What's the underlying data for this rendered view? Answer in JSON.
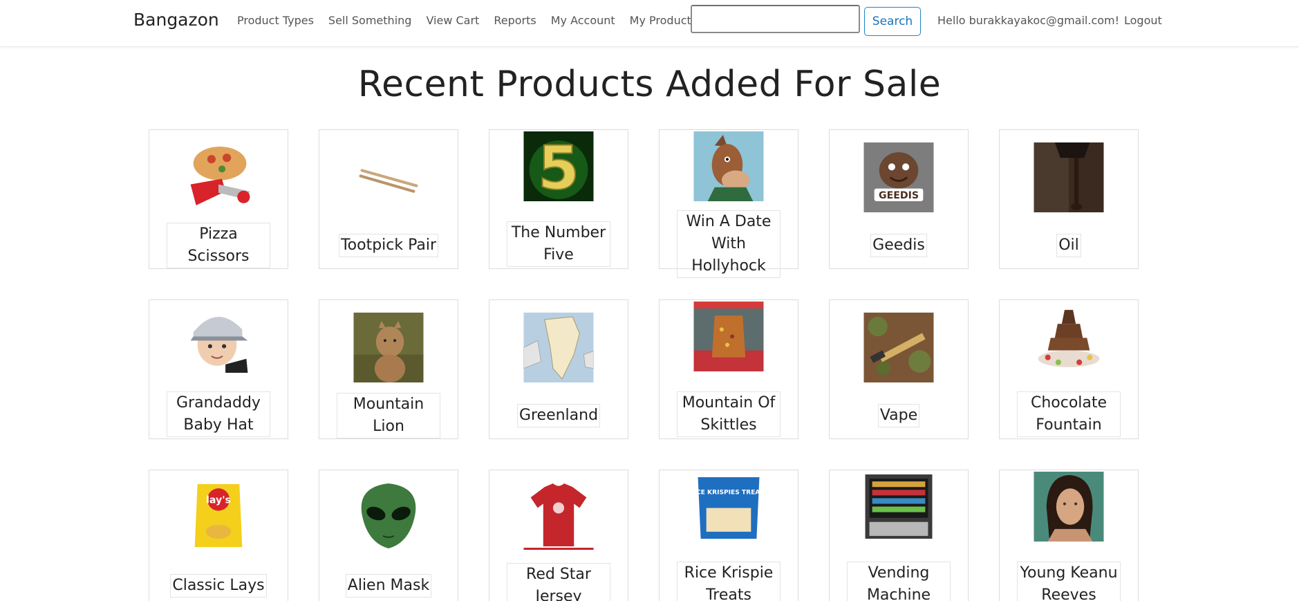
{
  "nav": {
    "brand": "Bangazon",
    "links": [
      "Product Types",
      "Sell Something",
      "View Cart",
      "Reports",
      "My Account",
      "My Products"
    ],
    "search_value": "",
    "search_button": "Search",
    "greeting": "Hello burakkayakoc@gmail.com!",
    "logout": "Logout"
  },
  "page": {
    "title": "Recent Products Added For Sale"
  },
  "products": [
    {
      "name": "Pizza Scissors",
      "icon": "pizza-scissors-image"
    },
    {
      "name": "Tootpick Pair",
      "icon": "toothpicks-image"
    },
    {
      "name": "The Number Five",
      "icon": "number-five-image"
    },
    {
      "name": "Win A Date With Hollyhock",
      "icon": "horse-cartoon-image"
    },
    {
      "name": "Geedis",
      "icon": "geedis-image"
    },
    {
      "name": "Oil",
      "icon": "oil-pour-image"
    },
    {
      "name": "Grandaddy Baby Hat",
      "icon": "baby-hat-image"
    },
    {
      "name": "Mountain Lion",
      "icon": "mountain-lion-image"
    },
    {
      "name": "Greenland",
      "icon": "greenland-map-image"
    },
    {
      "name": "Mountain Of Skittles",
      "icon": "skittles-image"
    },
    {
      "name": "Vape",
      "icon": "vape-image"
    },
    {
      "name": "Chocolate Fountain",
      "icon": "chocolate-fountain-image"
    },
    {
      "name": "Classic Lays",
      "icon": "lays-chips-image"
    },
    {
      "name": "Alien Mask",
      "icon": "alien-mask-image"
    },
    {
      "name": "Red Star Jersey",
      "icon": "red-jersey-image"
    },
    {
      "name": "Rice Krispie Treats",
      "icon": "rice-krispie-box-image"
    },
    {
      "name": "Vending Machine",
      "icon": "vending-machine-image"
    },
    {
      "name": "Young Keanu Reeves",
      "icon": "portrait-image"
    }
  ],
  "image_text": {
    "geedis_label": "GEEDIS",
    "lays_label": "lay's",
    "krispie_label": "RICE KRISPIES TREATS"
  },
  "colors": {
    "search_border": "#1b86c8",
    "text": "#212529"
  }
}
